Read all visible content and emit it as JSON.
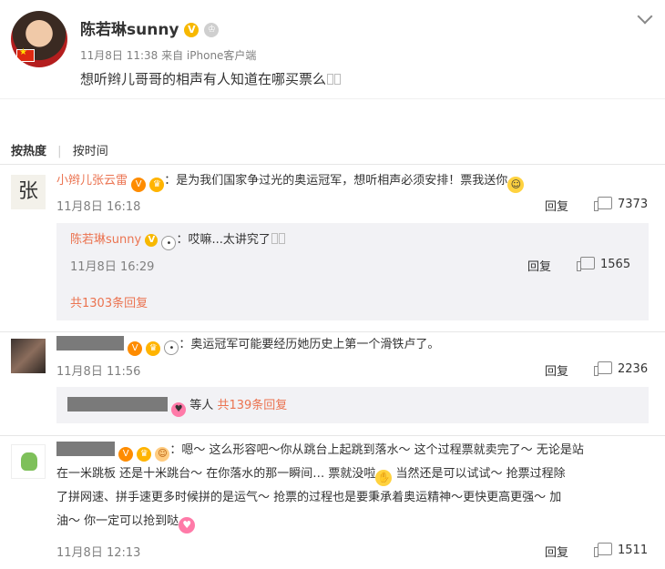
{
  "post": {
    "name": "陈若琳sunny",
    "meta": "11月8日 11:38 来自 iPhone客户端",
    "text": "想听辫儿哥哥的相声有人知道在哪买票么"
  },
  "sort": {
    "active": "按热度",
    "divider": "|",
    "other": "按时间"
  },
  "comments": [
    {
      "user": "小辫儿张云雷",
      "text": "：是为我们国家争过光的奥运冠军，想听相声必须安排！票我送你",
      "time": "11月8日 16:18",
      "reply": "回复",
      "likes": "7373",
      "sub": {
        "user": "陈若琳sunny",
        "text": "：哎嘛...太讲究了",
        "time": "11月8日 16:29",
        "reply": "回复",
        "likes": "1565",
        "more": "共1303条回复"
      }
    },
    {
      "text": "：奥运冠军可能要经历她历史上第一个滑铁卢了。",
      "time": "11月8日 11:56",
      "reply": "回复",
      "likes": "2236",
      "sub_text": "等人",
      "sub_more": "共139条回复"
    },
    {
      "line1": "：嗯～ 这么形容吧～你从跳台上起跳到落水～ 这个过程票就卖完了～ 无论是站",
      "line2a": "在一米跳板 还是十米跳台～ 在你落水的那一瞬间… 票就没啦",
      "line2b": "当然还是可以试试～ 抢票过程除",
      "line3": "了拼网速、拼手速更多时候拼的是运气～ 抢票的过程也是要秉承着奥运精神～更快更高更强～ 加",
      "line4": "油～ 你一定可以抢到哒",
      "time": "11月8日 12:13",
      "reply": "回复",
      "likes": "1511"
    }
  ],
  "icons": {
    "v_badge": "V",
    "chevron": "chevron-down-icon",
    "thumb": "thumb-up-icon"
  },
  "avatar_calligraphy": "张",
  "colors": {
    "username": "#eb7350",
    "meta": "#808080",
    "sub_bg": "#f2f2f5"
  }
}
